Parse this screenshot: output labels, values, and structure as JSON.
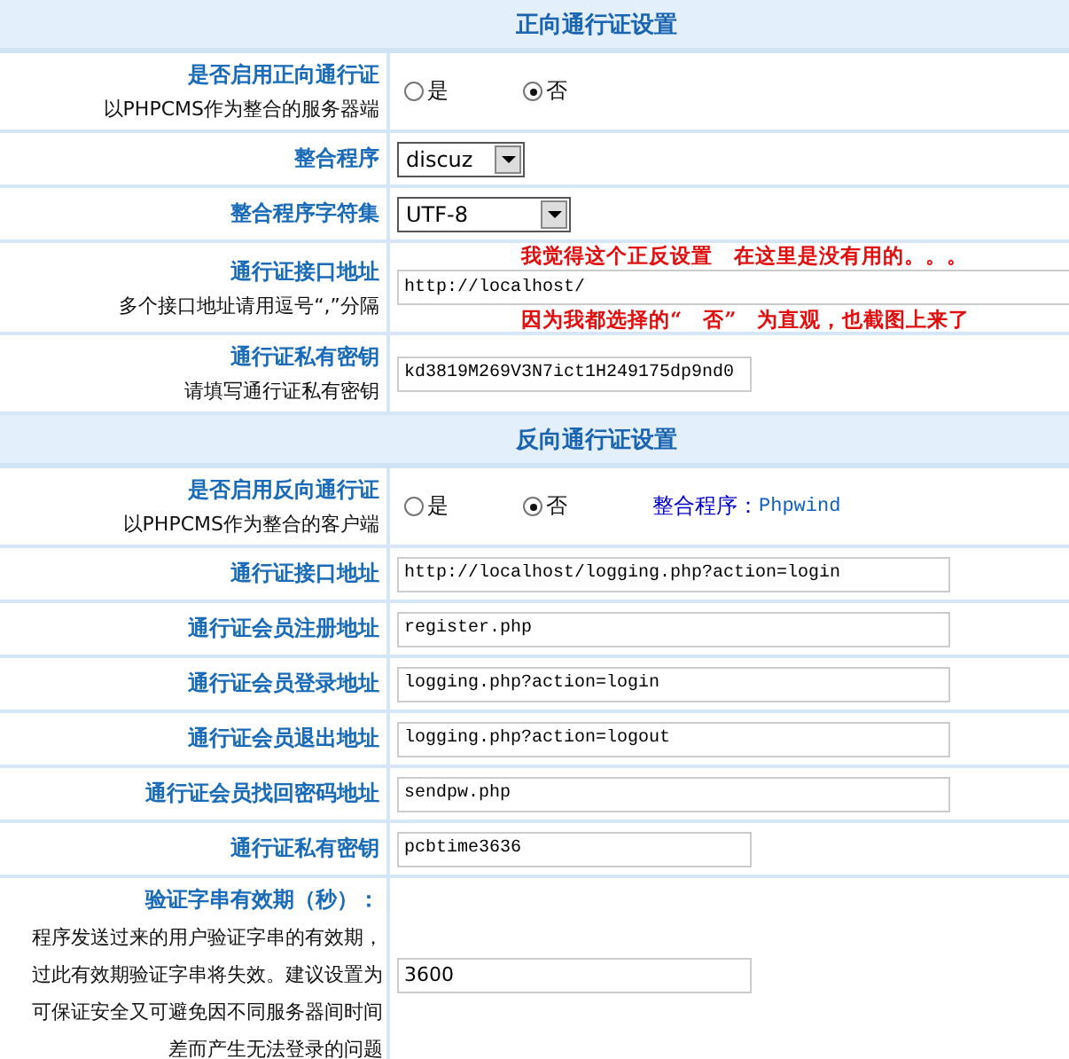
{
  "sections": [
    {
      "title": "正向通行证设置",
      "rows": [
        {
          "kind": "radio",
          "label": "是否启用正向通行证",
          "hint": [
            "以PHPCMS作为整合的服务器端"
          ],
          "options": [
            {
              "label": "是",
              "selected": false
            },
            {
              "label": "否",
              "selected": true
            }
          ]
        },
        {
          "kind": "select",
          "label": "整合程序",
          "value": "discuz"
        },
        {
          "kind": "wide-select",
          "label": "整合程序字符集",
          "value": "UTF-8"
        },
        {
          "kind": "long-text",
          "label": "通行证接口地址",
          "hint": [
            "多个接口地址请用逗号“,”分隔"
          ],
          "value": "http://localhost/",
          "note": [
            "我觉得这个正反设置　在这里是没有用的。。。",
            "因为我都选择的“　否”　为直观，也截图上来了"
          ]
        },
        {
          "kind": "text",
          "label": "通行证私有密钥",
          "hint": [
            "请填写通行证私有密钥"
          ],
          "value": "kd3819M269V3N7ict1H249175dp9nd0"
        }
      ]
    },
    {
      "title": "反向通行证设置",
      "rows": [
        {
          "kind": "radio",
          "label": "是否启用反向通行证",
          "hint": [
            "以PHPCMS作为整合的客户端"
          ],
          "options": [
            {
              "label": "是",
              "selected": false
            },
            {
              "label": "否",
              "selected": true
            }
          ],
          "extra": {
            "label": "整合程序：",
            "value": "Phpwind"
          }
        },
        {
          "kind": "wide-text",
          "label": "通行证接口地址",
          "value": "http://localhost/logging.php?action=login"
        },
        {
          "kind": "wide-text",
          "label": "通行证会员注册地址",
          "value": "register.php"
        },
        {
          "kind": "wide-text",
          "label": "通行证会员登录地址",
          "value": "logging.php?action=login"
        },
        {
          "kind": "wide-text",
          "label": "通行证会员退出地址",
          "value": "logging.php?action=logout"
        },
        {
          "kind": "wide-text",
          "label": "通行证会员找回密码地址",
          "value": "sendpw.php"
        },
        {
          "kind": "text",
          "label": "通行证私有密钥",
          "value": "pcbtime3636"
        },
        {
          "kind": "number",
          "label": "验证字串有效期（秒）：",
          "hint": [
            "程序发送过来的用户验证字串的有效期，",
            "过此有效期验证字串将失效。建议设置为",
            "可保证安全又可避免因不同服务器间时间",
            "差而产生无法登录的问题"
          ],
          "value": "3600"
        }
      ]
    }
  ]
}
